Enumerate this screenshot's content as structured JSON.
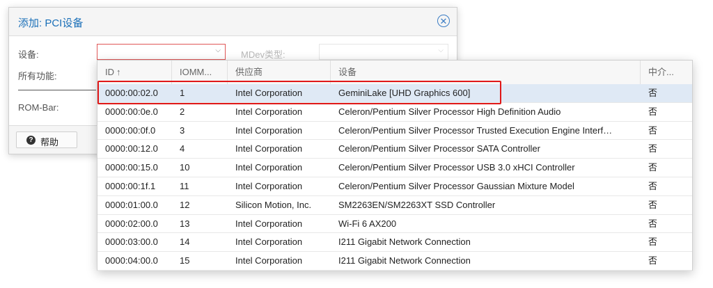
{
  "dialog": {
    "title": "添加: PCI设备",
    "fields": {
      "device_label": "设备:",
      "mdev_label": "MDev类型:",
      "all_functions_label": "所有功能:",
      "rombar_label": "ROM-Bar:"
    },
    "help_label": "帮助"
  },
  "grid": {
    "columns": [
      "ID",
      "IOMM...",
      "供应商",
      "设备",
      "中介..."
    ],
    "rows": [
      {
        "id": "0000:00:02.0",
        "iommu": "1",
        "vendor": "Intel Corporation",
        "device": "GeminiLake [UHD Graphics 600]",
        "mdev": "否"
      },
      {
        "id": "0000:00:0e.0",
        "iommu": "2",
        "vendor": "Intel Corporation",
        "device": "Celeron/Pentium Silver Processor High Definition Audio",
        "mdev": "否"
      },
      {
        "id": "0000:00:0f.0",
        "iommu": "3",
        "vendor": "Intel Corporation",
        "device": "Celeron/Pentium Silver Processor Trusted Execution Engine Interf…",
        "mdev": "否"
      },
      {
        "id": "0000:00:12.0",
        "iommu": "4",
        "vendor": "Intel Corporation",
        "device": "Celeron/Pentium Silver Processor SATA Controller",
        "mdev": "否"
      },
      {
        "id": "0000:00:15.0",
        "iommu": "10",
        "vendor": "Intel Corporation",
        "device": "Celeron/Pentium Silver Processor USB 3.0 xHCI Controller",
        "mdev": "否"
      },
      {
        "id": "0000:00:1f.1",
        "iommu": "11",
        "vendor": "Intel Corporation",
        "device": "Celeron/Pentium Silver Processor Gaussian Mixture Model",
        "mdev": "否"
      },
      {
        "id": "0000:01:00.0",
        "iommu": "12",
        "vendor": "Silicon Motion, Inc.",
        "device": "SM2263EN/SM2263XT SSD Controller",
        "mdev": "否"
      },
      {
        "id": "0000:02:00.0",
        "iommu": "13",
        "vendor": "Intel Corporation",
        "device": "Wi-Fi 6 AX200",
        "mdev": "否"
      },
      {
        "id": "0000:03:00.0",
        "iommu": "14",
        "vendor": "Intel Corporation",
        "device": "I211 Gigabit Network Connection",
        "mdev": "否"
      },
      {
        "id": "0000:04:00.0",
        "iommu": "15",
        "vendor": "Intel Corporation",
        "device": "I211 Gigabit Network Connection",
        "mdev": "否"
      }
    ]
  },
  "colors": {
    "accent": "#1a6fb8",
    "selected_row": "#dfe9f5",
    "highlight_box": "#e01818"
  }
}
